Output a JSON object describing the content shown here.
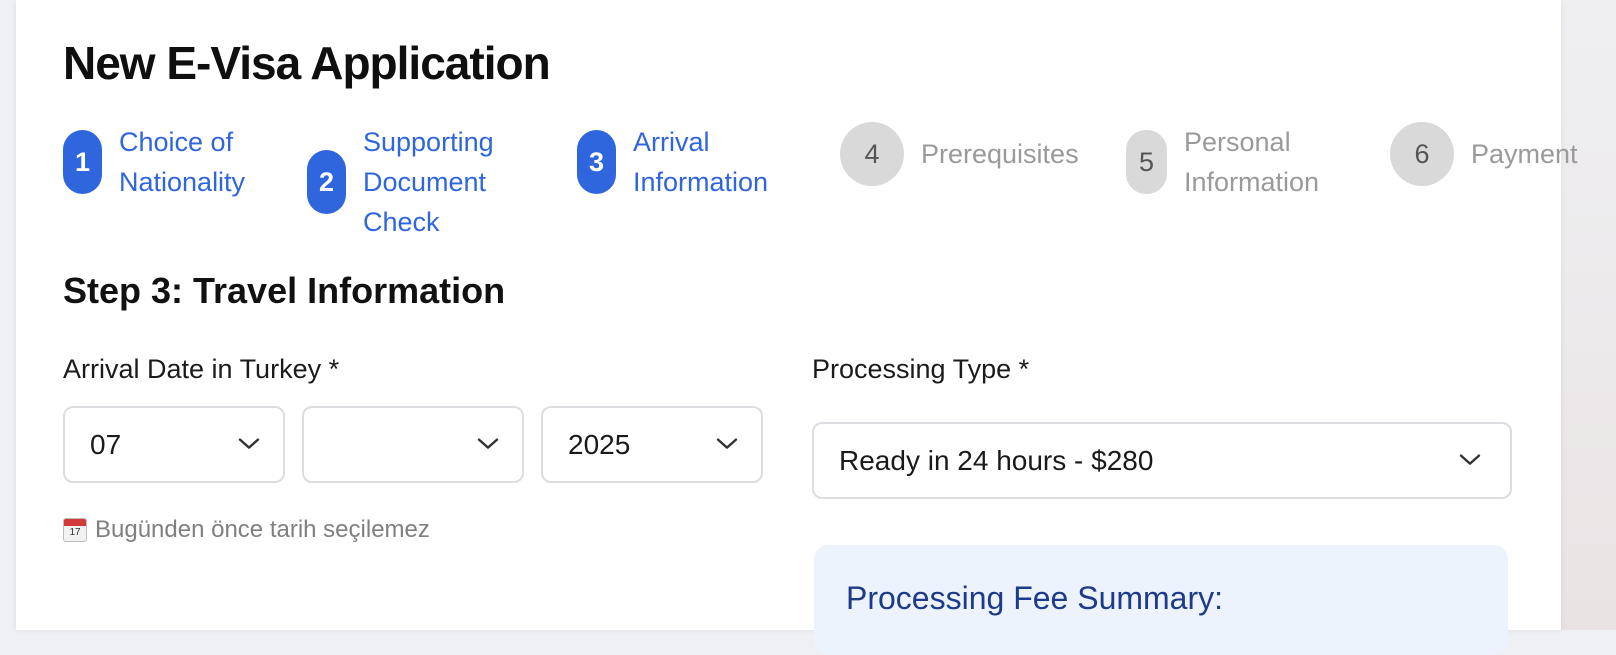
{
  "page": {
    "title": "New E-Visa Application"
  },
  "stepper": {
    "steps": [
      {
        "number": "1",
        "label": "Choice of Nationality",
        "state": "active"
      },
      {
        "number": "2",
        "label": "Supporting Document Check",
        "state": "active"
      },
      {
        "number": "3",
        "label": "Arrival Information",
        "state": "active"
      },
      {
        "number": "4",
        "label": "Prerequisites",
        "state": "inactive"
      },
      {
        "number": "5",
        "label": "Personal Information",
        "state": "inactive"
      },
      {
        "number": "6",
        "label": "Payment",
        "state": "inactive"
      }
    ]
  },
  "form": {
    "section_title": "Step 3: Travel Information",
    "arrival_date": {
      "label": "Arrival Date in Turkey *",
      "month": "07",
      "day": "",
      "year": "2025",
      "hint": "Bugünden önce tarih seçilemez",
      "hint_icon": "calendar-icon",
      "hint_icon_day": "17"
    },
    "processing_type": {
      "label": "Processing Type *",
      "value": "Ready in 24 hours - $280"
    },
    "fee_summary": {
      "title": "Processing Fee Summary:"
    }
  },
  "colors": {
    "accent": "#2f66de",
    "inactive_step": "#d9d9d9",
    "summary_bg": "#edf3fc",
    "summary_title": "#1e3a8a"
  }
}
